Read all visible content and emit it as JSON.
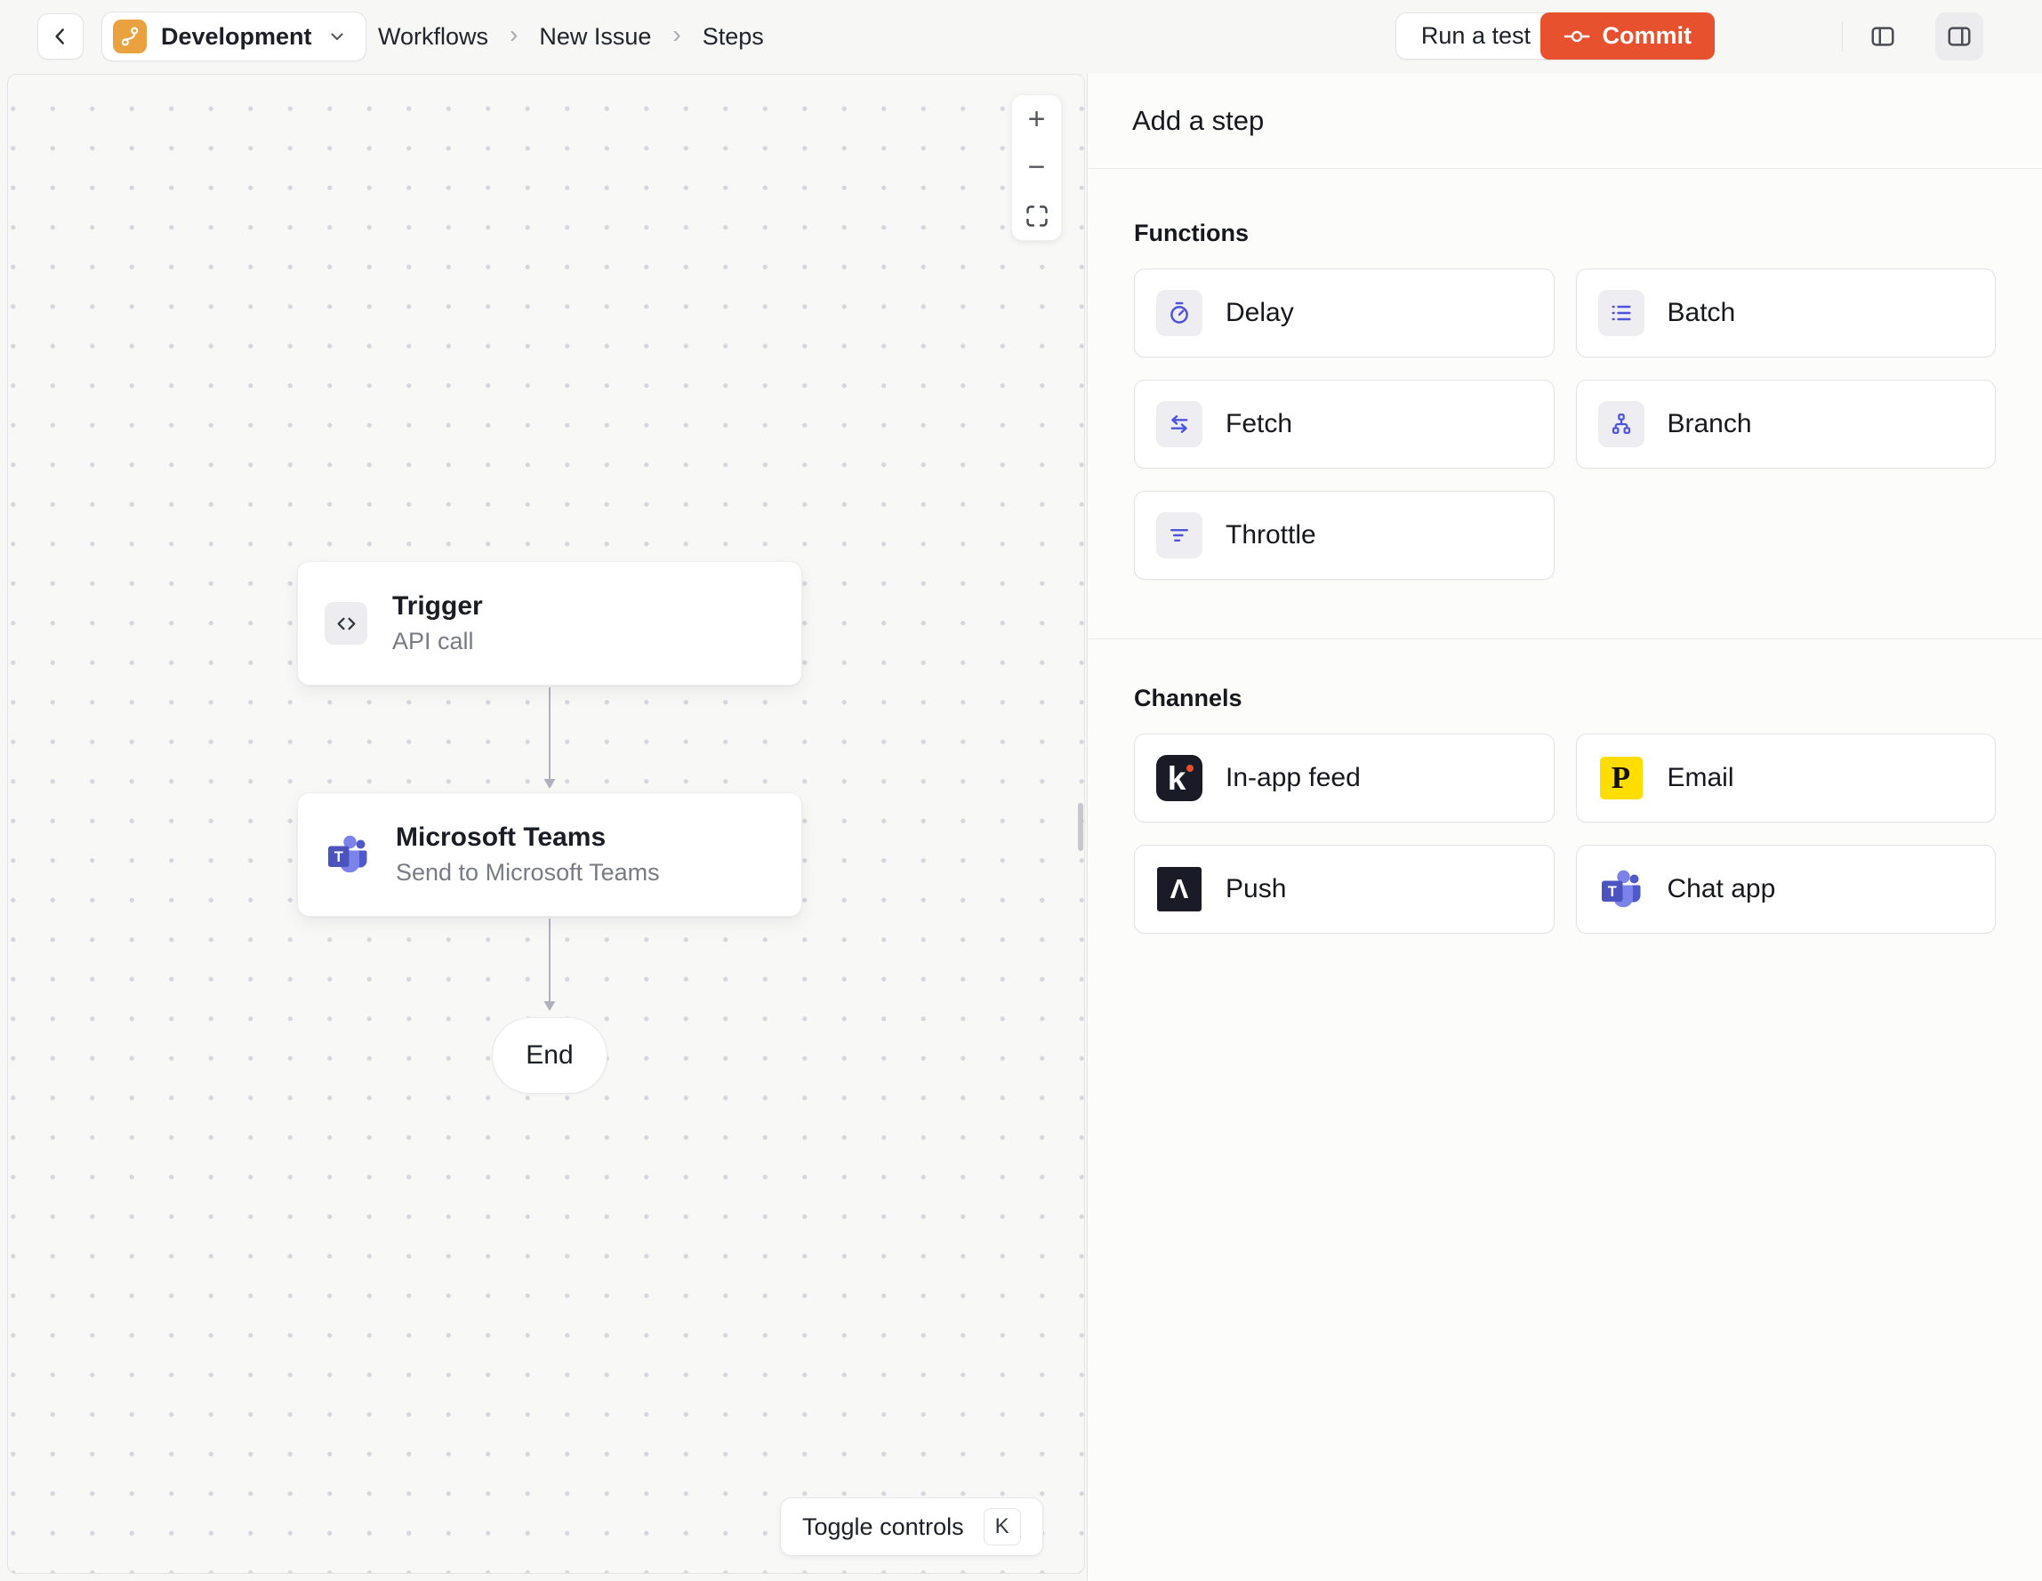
{
  "topbar": {
    "environment": "Development",
    "breadcrumb": {
      "items": [
        "Workflows",
        "New Issue",
        "Steps"
      ],
      "separator": "›"
    },
    "run_test": "Run a test",
    "commit": "Commit"
  },
  "canvas": {
    "zoom_in": "+",
    "zoom_out": "−",
    "nodes": {
      "trigger": {
        "title": "Trigger",
        "subtitle": "API call"
      },
      "teams": {
        "title": "Microsoft Teams",
        "subtitle": "Send to Microsoft Teams"
      },
      "end": {
        "label": "End"
      }
    },
    "toggle_controls": {
      "label": "Toggle controls",
      "shortcut": "K"
    }
  },
  "panel": {
    "title": "Add a step",
    "functions": {
      "label": "Functions",
      "items": [
        {
          "label": "Delay",
          "icon": "stopwatch-icon"
        },
        {
          "label": "Batch",
          "icon": "list-icon"
        },
        {
          "label": "Fetch",
          "icon": "transfer-arrows-icon"
        },
        {
          "label": "Branch",
          "icon": "hierarchy-icon"
        },
        {
          "label": "Throttle",
          "icon": "filter-lines-icon"
        }
      ]
    },
    "channels": {
      "label": "Channels",
      "items": [
        {
          "label": "In-app feed",
          "icon": "knock-logo"
        },
        {
          "label": "Email",
          "icon": "postmark-logo"
        },
        {
          "label": "Push",
          "icon": "expo-logo"
        },
        {
          "label": "Chat app",
          "icon": "ms-teams-logo"
        }
      ]
    },
    "logo_letters": {
      "knock": "k",
      "postmark": "P",
      "expo": "Λ",
      "teams": "T"
    }
  },
  "colors": {
    "commit_accent": "#E8512D",
    "environment_icon": "#E9A23F",
    "function_icon": "#4C53DE",
    "postmark_yellow": "#FFDD00",
    "dark_logo": "#191C26",
    "teams_purple_dark": "#4B53BC",
    "teams_purple_light": "#7B83EB"
  }
}
